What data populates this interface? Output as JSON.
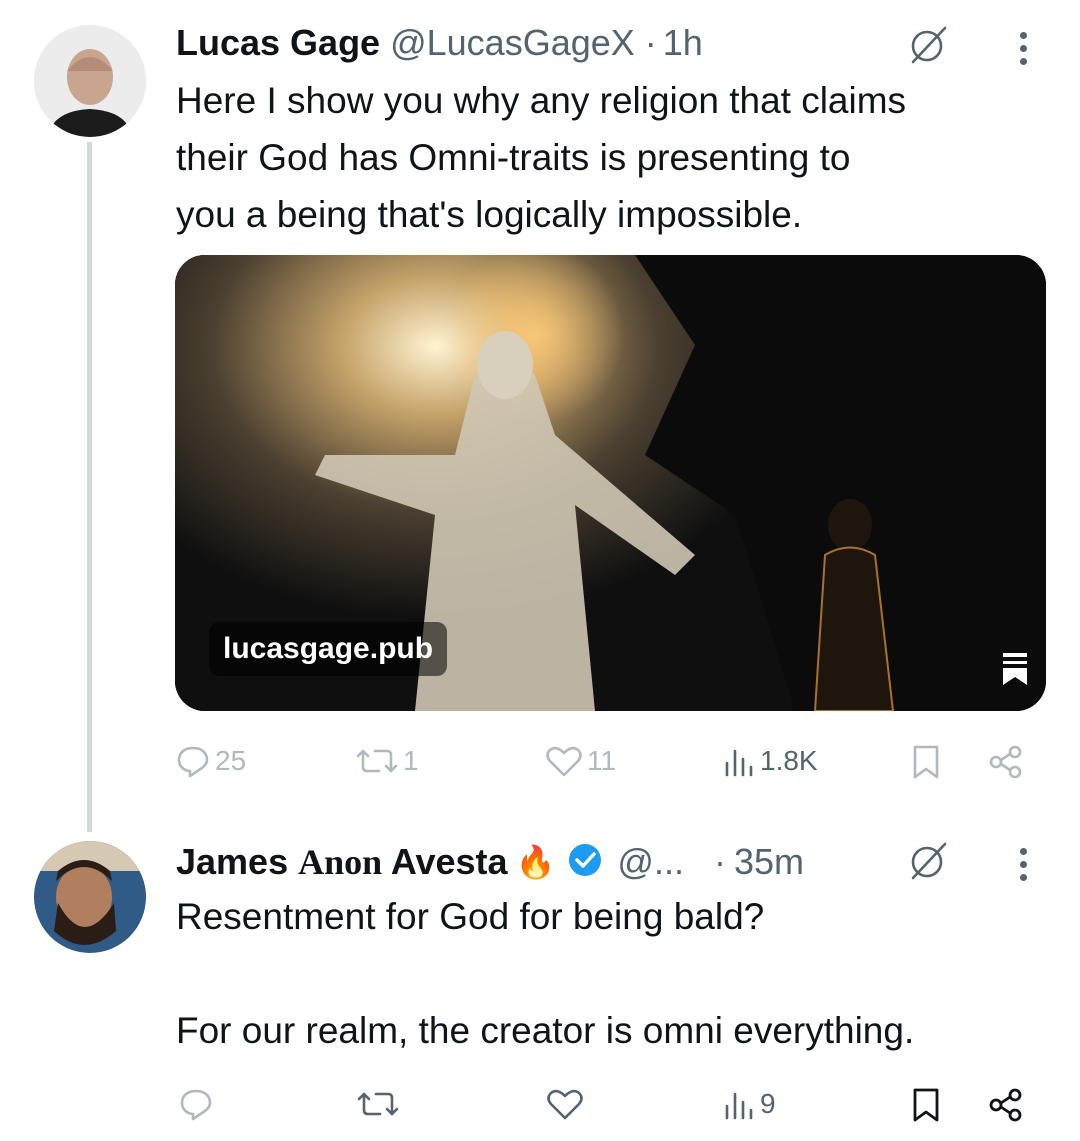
{
  "tweet1": {
    "author_name": "Lucas Gage",
    "handle": "@LucasGageX",
    "separator": "·",
    "time": "1h",
    "text_lines": [
      "Here I show you why any religion that claims",
      "their God has Omni-traits is presenting to",
      "you a being that's logically impossible."
    ],
    "link_label": "lucasgage.pub",
    "stats": {
      "replies": "25",
      "reposts": "1",
      "likes": "11",
      "views": "1.8K"
    }
  },
  "tweet2": {
    "author_name": "James ",
    "author_name_mid": "Anon",
    "author_name_end": " Avesta",
    "emoji": "🔥",
    "handle": "@...",
    "separator": "·",
    "time": "35m",
    "text_lines": [
      "Resentment for God for being bald?",
      "",
      "For our realm, the creator is omni everything."
    ],
    "stats": {
      "views": "9"
    }
  },
  "icons": {
    "grok": "grok-icon",
    "more": "more-options-icon",
    "reply": "reply-icon",
    "repost": "repost-icon",
    "like": "like-icon",
    "views": "views-icon",
    "bookmark": "bookmark-icon",
    "share": "share-icon",
    "verified": "verified-badge-icon"
  },
  "colors": {
    "text": "#0f1419",
    "muted": "#536471",
    "verified": "#1d9bf0",
    "thread_line": "#cfd9de"
  }
}
